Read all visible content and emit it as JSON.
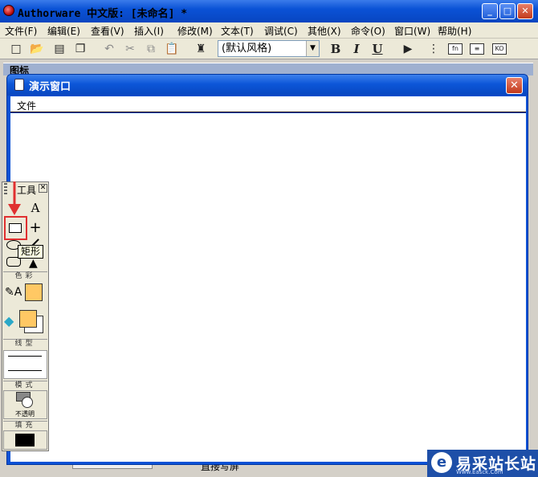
{
  "app": {
    "title": "Authorware 中文版: [未命名] *",
    "minimize": "_",
    "maximize": "□",
    "close": "✕"
  },
  "menu": [
    "文件(F)",
    "编辑(E)",
    "查看(V)",
    "插入(I)",
    "修改(M)",
    "文本(T)",
    "调试(C)",
    "其他(X)",
    "命令(O)",
    "窗口(W)",
    "帮助(H)"
  ],
  "toolbar": {
    "style_value": "(默认风格)",
    "bold": "B",
    "italic": "I",
    "underline": "U",
    "fn_label": "fn",
    "ko_label": "KO"
  },
  "background_window": {
    "label": "图标"
  },
  "presentation": {
    "title": "演示窗口",
    "menu_file": "文件",
    "close": "✕"
  },
  "palette": {
    "title": "工具",
    "close": "✕",
    "text_tool": "A",
    "cross_tool": "+",
    "tooltip": "矩形",
    "color_label": "色彩",
    "linetype_label": "线型",
    "mode_label": "模式",
    "mode_value": "不透明",
    "fill_label": "填充",
    "fill_color": "#000000",
    "swatch_color": "#ffc864"
  },
  "status": {
    "text": "直接写屏"
  },
  "watermark": {
    "text": "易采站长站",
    "sub": "Www.Easck.Com"
  }
}
